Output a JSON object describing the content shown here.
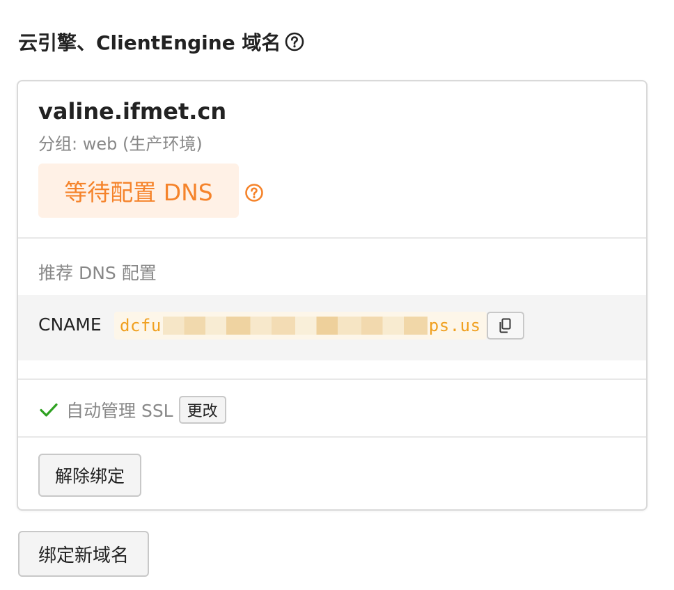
{
  "section": {
    "title": "云引擎、ClientEngine 域名",
    "help_icon": "question-circle-icon"
  },
  "card": {
    "domain": "valine.ifmet.cn",
    "group_line": "分组: web (生产环境)",
    "status": {
      "label": "等待配置 DNS",
      "color": "#f5832a",
      "bg_color": "#fff1e6",
      "help_icon": "question-circle-icon"
    },
    "recommended_dns": {
      "title": "推荐 DNS 配置",
      "record_type": "CNAME",
      "value_prefix": "dcfu",
      "value_suffix": "ps.us",
      "copy_icon": "copy-icon"
    },
    "ssl": {
      "icon": "check-icon",
      "icon_color": "#2ea121",
      "label": "自动管理 SSL",
      "change_button": "更改"
    },
    "unbind_button": "解除绑定"
  },
  "bind_new_button": "绑定新域名"
}
